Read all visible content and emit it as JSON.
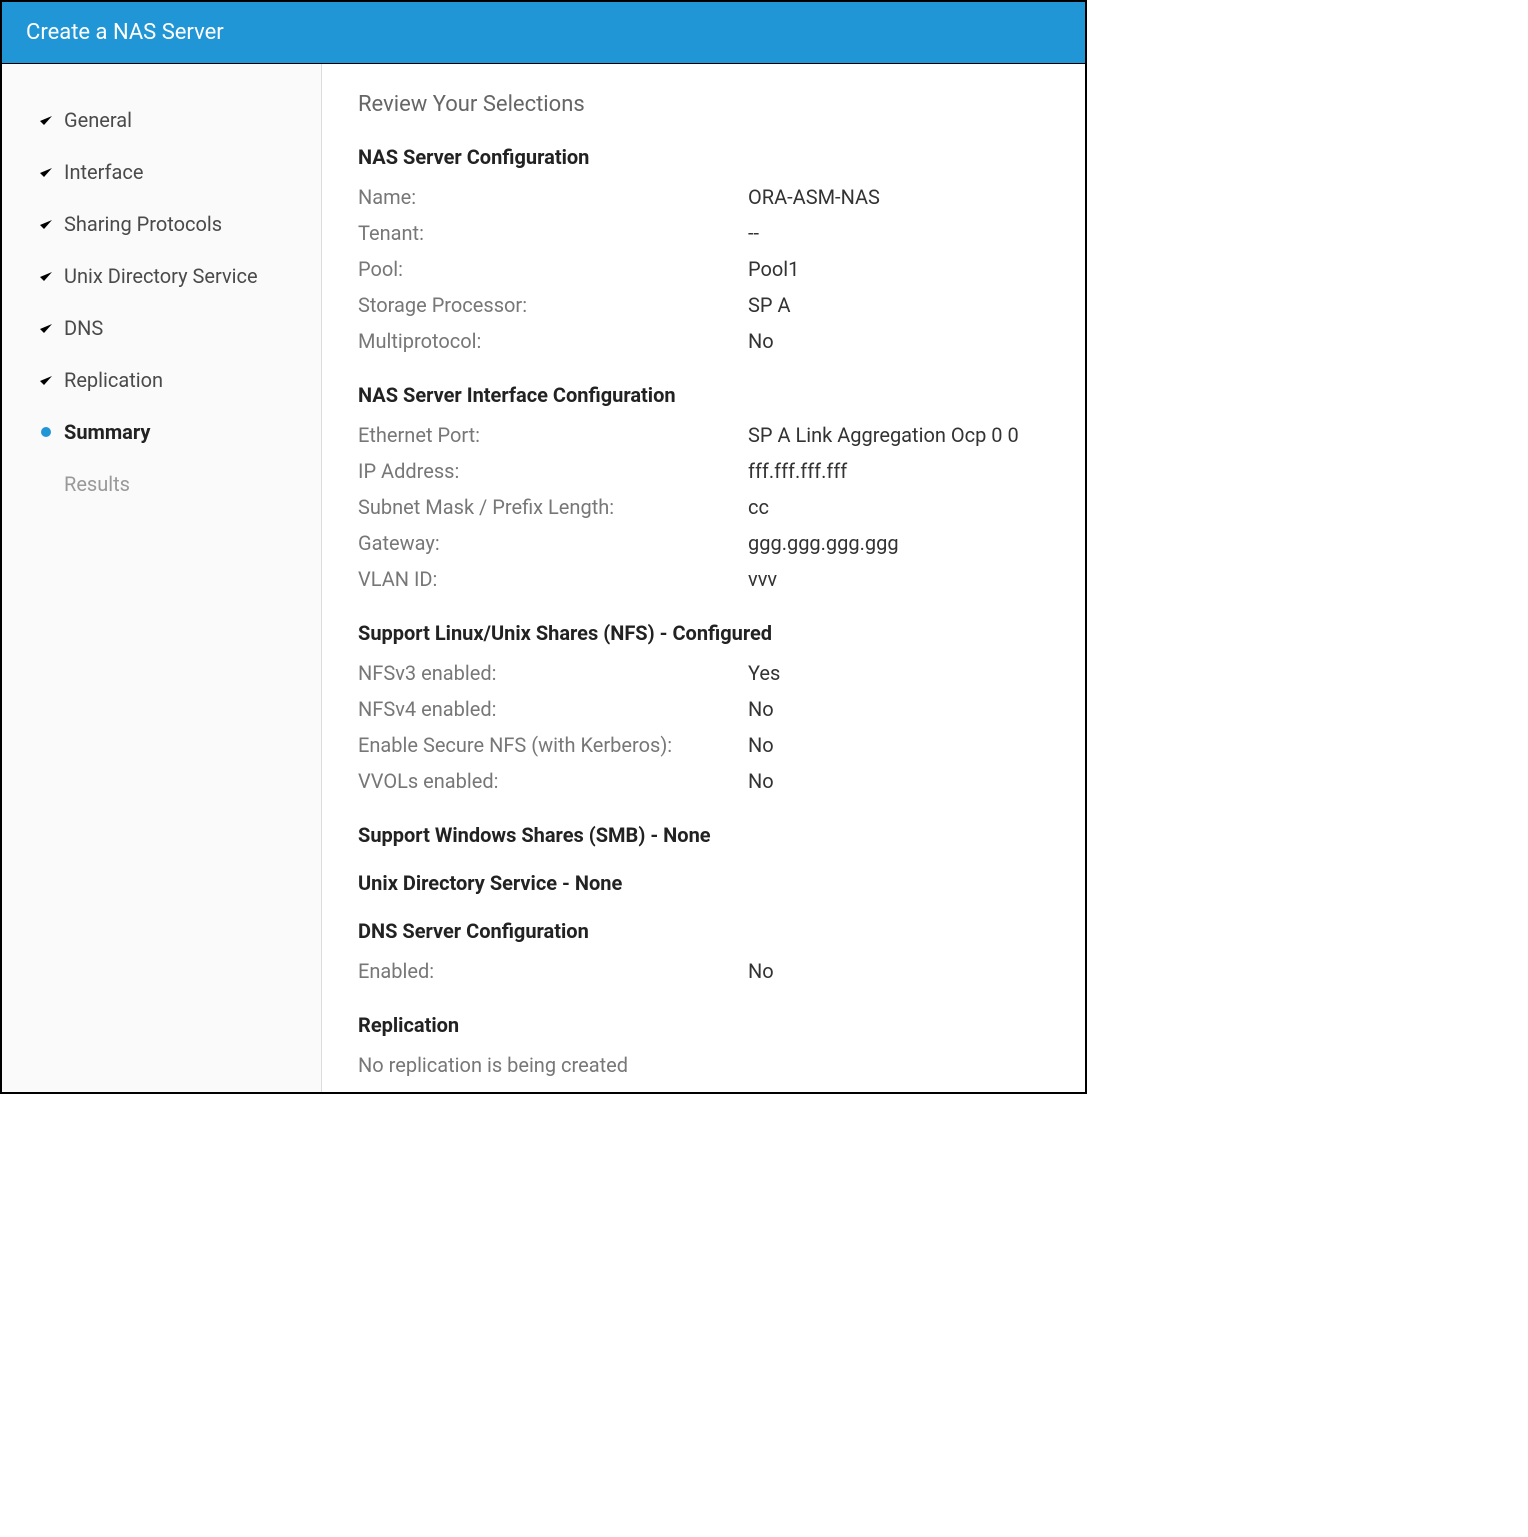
{
  "title": "Create a NAS Server",
  "steps": [
    {
      "label": "General",
      "state": "done"
    },
    {
      "label": "Interface",
      "state": "done"
    },
    {
      "label": "Sharing Protocols",
      "state": "done"
    },
    {
      "label": "Unix Directory Service",
      "state": "done"
    },
    {
      "label": "DNS",
      "state": "done"
    },
    {
      "label": "Replication",
      "state": "done"
    },
    {
      "label": "Summary",
      "state": "current"
    },
    {
      "label": "Results",
      "state": "upcoming"
    }
  ],
  "main": {
    "heading": "Review Your Selections",
    "sections": {
      "nas_config": {
        "title": "NAS Server Configuration",
        "rows": {
          "name": {
            "label": "Name:",
            "value": "ORA-ASM-NAS"
          },
          "tenant": {
            "label": "Tenant:",
            "value": "--"
          },
          "pool": {
            "label": "Pool:",
            "value": "Pool1"
          },
          "sp": {
            "label": "Storage Processor:",
            "value": "SP A"
          },
          "multiprotocol": {
            "label": "Multiprotocol:",
            "value": "No"
          }
        }
      },
      "iface": {
        "title": "NAS Server Interface Configuration",
        "rows": {
          "port": {
            "label": "Ethernet Port:",
            "value": "SP A Link Aggregation Ocp 0 0"
          },
          "ip": {
            "label": "IP Address:",
            "value": "fff.fff.fff.fff"
          },
          "mask": {
            "label": "Subnet Mask / Prefix Length:",
            "value": "cc"
          },
          "gateway": {
            "label": "Gateway:",
            "value": "ggg.ggg.ggg.ggg"
          },
          "vlan": {
            "label": "VLAN ID:",
            "value": "vvv"
          }
        }
      },
      "nfs": {
        "title": "Support Linux/Unix Shares (NFS) - Configured",
        "rows": {
          "v3": {
            "label": "NFSv3 enabled:",
            "value": "Yes"
          },
          "v4": {
            "label": "NFSv4 enabled:",
            "value": "No"
          },
          "secure": {
            "label": "Enable Secure NFS (with Kerberos):",
            "value": "No"
          },
          "vvols": {
            "label": "VVOLs enabled:",
            "value": "No"
          }
        }
      },
      "smb": {
        "title": "Support Windows Shares (SMB) - None"
      },
      "uds": {
        "title": "Unix Directory Service - None"
      },
      "dns": {
        "title": "DNS Server Configuration",
        "rows": {
          "enabled": {
            "label": "Enabled:",
            "value": "No"
          }
        }
      },
      "replication": {
        "title": "Replication",
        "info": "No replication is being created"
      }
    }
  }
}
